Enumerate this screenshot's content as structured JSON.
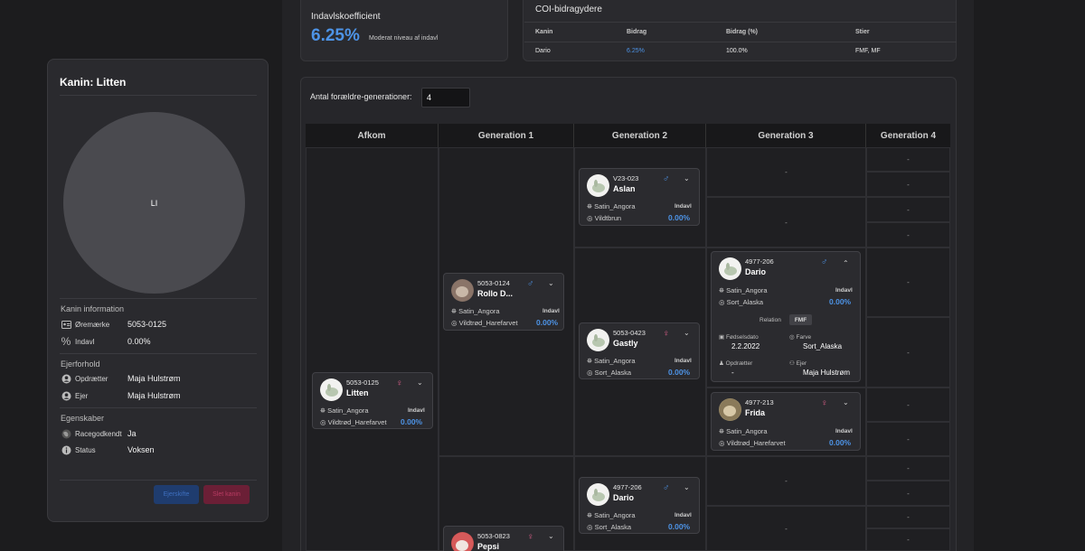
{
  "rabbit_card": {
    "title": "Kanin: Litten",
    "avatar_initials": "LI",
    "section_info": "Kanin information",
    "ear_label": "Øremærke",
    "ear_value": "5053-0125",
    "inbreed_label": "Indavl",
    "inbreed_value": "0.00%",
    "section_owner": "Ejerforhold",
    "breeder_label": "Opdrætter",
    "breeder_value": "Maja Hulstrøm",
    "owner_label": "Ejer",
    "owner_value": "Maja Hulstrøm",
    "section_props": "Egenskaber",
    "race_label": "Racegodkendt",
    "race_value": "Ja",
    "status_label": "Status",
    "status_value": "Voksen",
    "btn_owner": "Ejerskifte",
    "btn_delete": "Slet kanin"
  },
  "inbreeding": {
    "title": "Indavlskoefficient",
    "value": "6.25%",
    "description": "Moderat niveau af indavl"
  },
  "coi": {
    "title": "COI-bidragydere",
    "headers": [
      "Kanin",
      "Bidrag",
      "Bidrag (%)",
      "Stier"
    ],
    "rows": [
      [
        "Dario",
        "6.25%",
        "100.0%",
        "FMF, MF"
      ]
    ]
  },
  "pedigree": {
    "gen_label": "Antal forældre-generationer:",
    "gen_value": "4",
    "columns": [
      "Afkom",
      "Generation 1",
      "Generation 2",
      "Generation 3",
      "Generation 4"
    ],
    "empty": "-",
    "indavl_tag": "Indavl",
    "relation_label": "Relation",
    "relation_value": "FMF",
    "dob_label": "Fødselsdato",
    "dob_value": "2.2.2022",
    "color_label": "Farve",
    "color_value": "Sort_Alaska",
    "breeder_label": "Opdrætter",
    "breeder_value": "-",
    "owner_label": "Ejer",
    "owner_value": "Maja Hulstrøm",
    "rabbits": {
      "litten": {
        "id": "5053-0125",
        "name": "Litten",
        "sex": "♀",
        "breed": "Satin_Angora",
        "color": "Vildtrød_Harefarvet",
        "pct": "0.00%"
      },
      "rollo": {
        "id": "5053-0124",
        "name": "Rollo D...",
        "sex": "♂",
        "breed": "Satin_Angora",
        "color": "Vildtrød_Harefarvet",
        "pct": "0.00%"
      },
      "pepsi": {
        "id": "5053-0823",
        "name": "Pepsi",
        "sex": "♀"
      },
      "aslan": {
        "id": "V23-023",
        "name": "Aslan",
        "sex": "♂",
        "breed": "Satin_Angora",
        "color": "Vildtbrun",
        "pct": "0.00%"
      },
      "gastly": {
        "id": "5053-0423",
        "name": "Gastly",
        "sex": "♀",
        "breed": "Satin_Angora",
        "color": "Sort_Alaska",
        "pct": "0.00%"
      },
      "dario2": {
        "id": "4977-206",
        "name": "Dario",
        "sex": "♂",
        "breed": "Satin_Angora",
        "color": "Sort_Alaska",
        "pct": "0.00%"
      },
      "dario3": {
        "id": "4977-206",
        "name": "Dario",
        "sex": "♂",
        "breed": "Satin_Angora",
        "color": "Sort_Alaska",
        "pct": "0.00%"
      },
      "frida": {
        "id": "4977-213",
        "name": "Frida",
        "sex": "♀",
        "breed": "Satin_Angora",
        "color": "Vildtrød_Harefarvet",
        "pct": "0.00%"
      }
    }
  }
}
